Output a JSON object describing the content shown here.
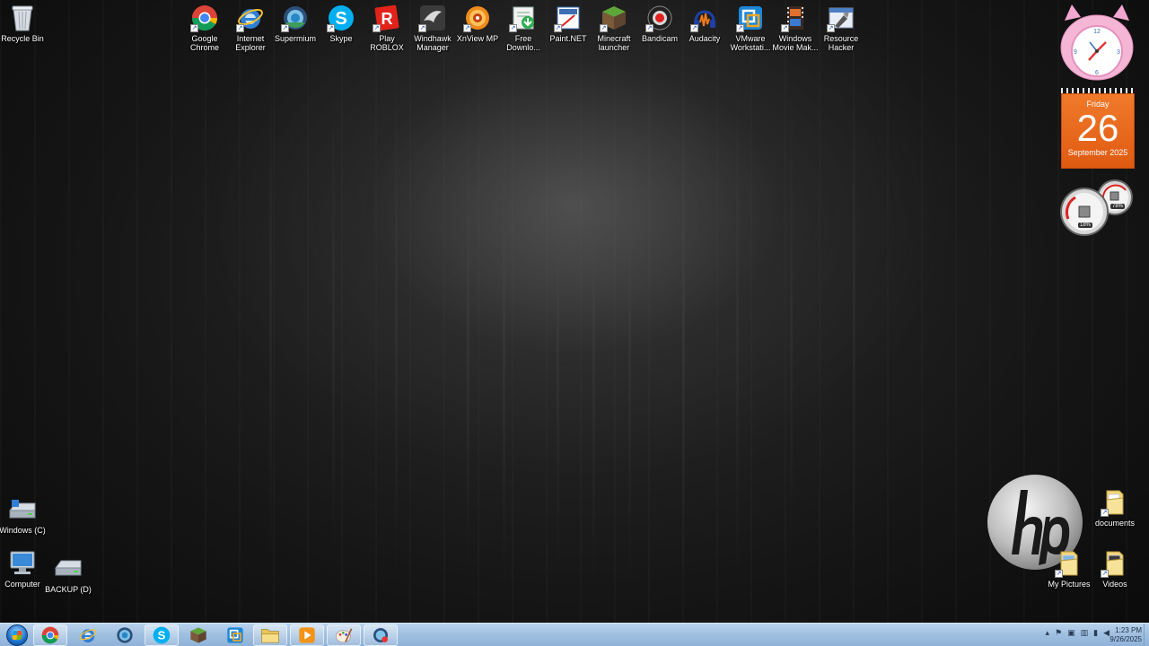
{
  "desktop": {
    "top_icons": [
      {
        "name": "recycle-bin",
        "label": "Recycle Bin"
      },
      {
        "name": "google-chrome",
        "label": "Google Chrome"
      },
      {
        "name": "internet-explorer",
        "label": "Internet Explorer"
      },
      {
        "name": "supermium",
        "label": "Supermium"
      },
      {
        "name": "skype",
        "label": "Skype"
      },
      {
        "name": "play-roblox",
        "label": "Play ROBLOX"
      },
      {
        "name": "windhawk-manager",
        "label": "Windhawk Manager"
      },
      {
        "name": "xnview-mp",
        "label": "XnView MP"
      },
      {
        "name": "free-download",
        "label": "Free Downlo..."
      },
      {
        "name": "paint-net",
        "label": "Paint.NET"
      },
      {
        "name": "minecraft-launcher",
        "label": "Minecraft launcher"
      },
      {
        "name": "bandicam",
        "label": "Bandicam"
      },
      {
        "name": "audacity",
        "label": "Audacity"
      },
      {
        "name": "vmware-workstation",
        "label": "VMware Workstati..."
      },
      {
        "name": "windows-movie-maker",
        "label": "Windows Movie Mak..."
      },
      {
        "name": "resource-hacker",
        "label": "Resource Hacker"
      }
    ],
    "bottom_left_icons": [
      {
        "name": "windows-c",
        "label": "Windows (C)"
      },
      {
        "name": "computer",
        "label": "Computer"
      },
      {
        "name": "backup-d",
        "label": "BACKUP (D)"
      }
    ],
    "bottom_right_icons": [
      {
        "name": "documents",
        "label": "documents"
      },
      {
        "name": "my-pictures",
        "label": "My Pictures"
      },
      {
        "name": "videos",
        "label": "Videos"
      }
    ]
  },
  "gadgets": {
    "calendar": {
      "day_name": "Friday",
      "day": "26",
      "month_year": "September 2025"
    },
    "cpu_meter": {
      "cpu": "18%",
      "memory": "78%"
    }
  },
  "taskbar": {
    "pinned": [
      "chrome-icon",
      "ie-icon",
      "supermium-icon",
      "skype-icon",
      "minecraft-icon",
      "vmware-icon",
      "explorer-icon",
      "media-player-icon",
      "paint-icon",
      "network-icon"
    ],
    "clock": {
      "time": "1:23 PM",
      "date": "9/26/2025"
    }
  },
  "colors": {
    "calendar_orange": "#e8641c",
    "taskbar": "#a6c4e4",
    "accent": "#1b6fc8"
  }
}
